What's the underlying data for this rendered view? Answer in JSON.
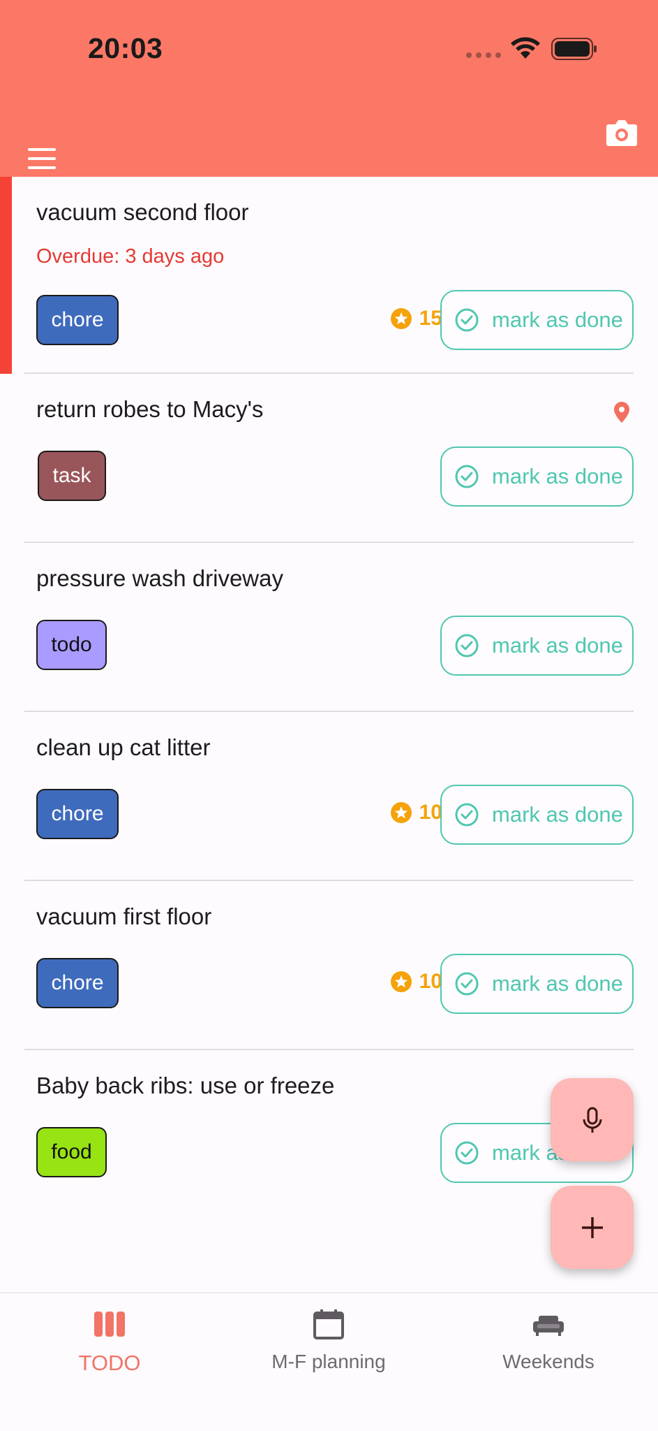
{
  "status_bar": {
    "time": "20:03"
  },
  "colors": {
    "accent": "#fc7866",
    "done": "#4fc7b0",
    "overdue": "#e53935",
    "points": "#f5a20b"
  },
  "todos": [
    {
      "title": "vacuum second floor",
      "overdue": "Overdue: 3 days ago",
      "tag": "chore",
      "points": "15",
      "done_label": "mark as done"
    },
    {
      "title": "return robes to Macy's",
      "tag": "task",
      "done_label": "mark as done",
      "icon": "location-pin-icon"
    },
    {
      "title": "pressure wash driveway",
      "tag": "todo",
      "done_label": "mark as done"
    },
    {
      "title": "clean up cat litter",
      "tag": "chore",
      "points": "10",
      "done_label": "mark as done"
    },
    {
      "title": "vacuum first floor",
      "tag": "chore",
      "points": "10",
      "done_label": "mark as done"
    },
    {
      "title": "Baby back ribs: use or freeze",
      "tag": "food",
      "done_label": "mark as done"
    }
  ],
  "bottom_nav": [
    {
      "label": "TODO",
      "icon": "columns-icon",
      "active": true
    },
    {
      "label": "M-F planning",
      "icon": "calendar-icon",
      "active": false
    },
    {
      "label": "Weekends",
      "icon": "couch-icon",
      "active": false
    }
  ]
}
